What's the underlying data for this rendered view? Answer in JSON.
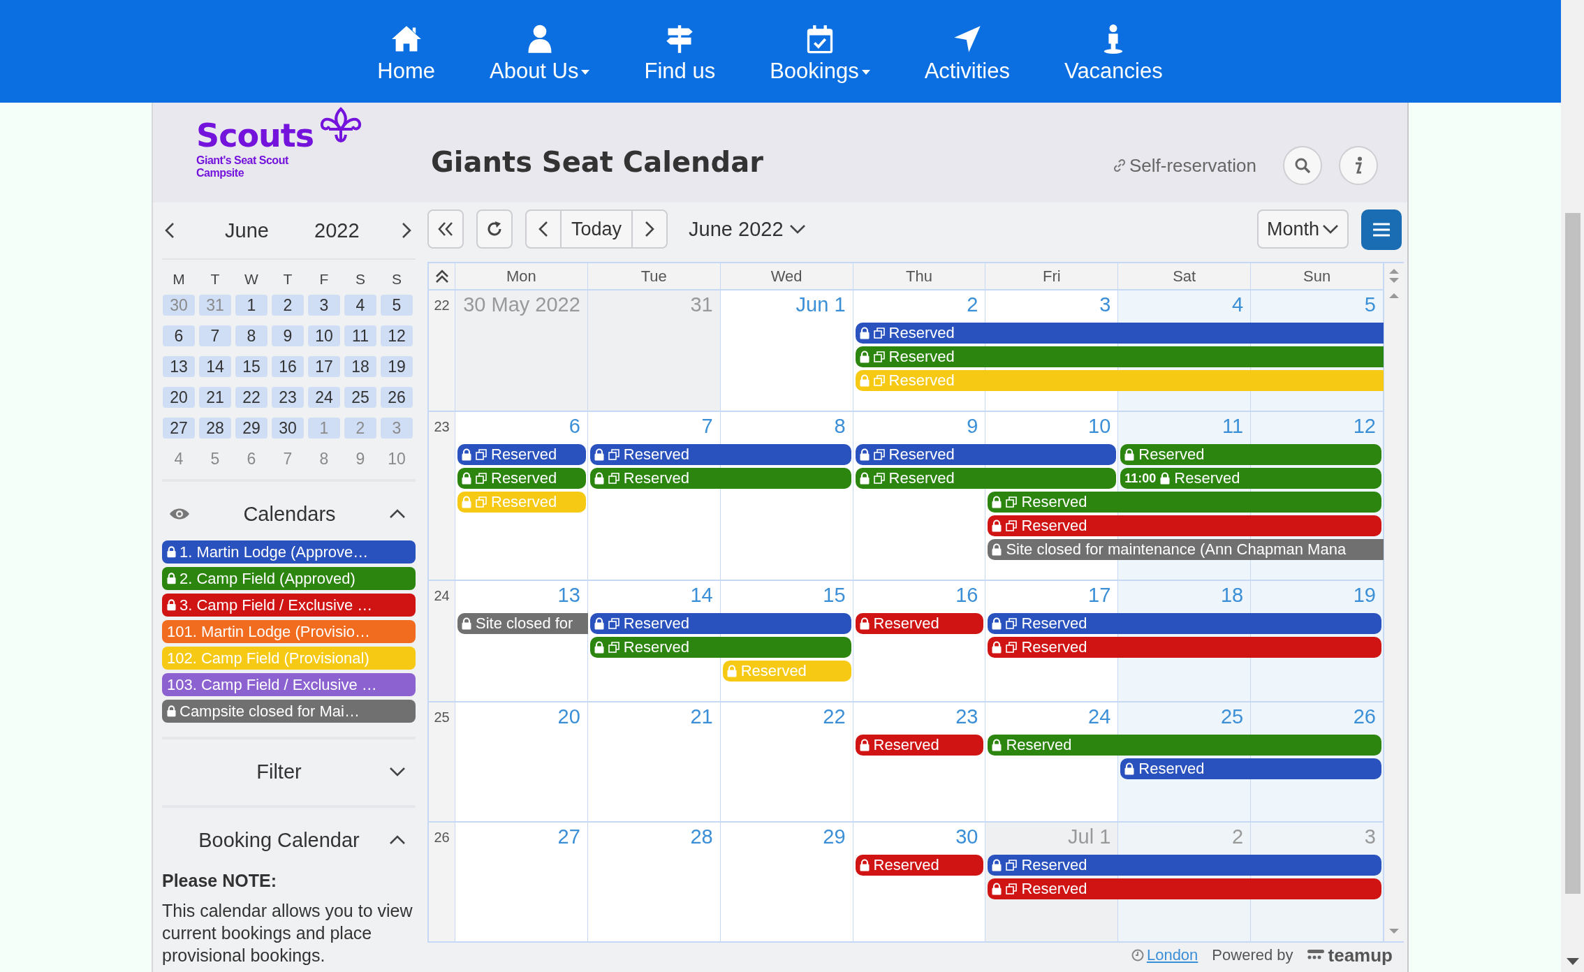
{
  "nav": [
    {
      "label": "Home",
      "dropdown": false
    },
    {
      "label": "About Us",
      "dropdown": true
    },
    {
      "label": "Find us",
      "dropdown": false
    },
    {
      "label": "Bookings",
      "dropdown": true
    },
    {
      "label": "Activities",
      "dropdown": false
    },
    {
      "label": "Vacancies",
      "dropdown": false
    }
  ],
  "logo": {
    "name": "Scouts",
    "lines": [
      "Giant's Seat Scout",
      "Campsite"
    ]
  },
  "title": "Giants Seat Calendar",
  "self_reservation": "Self-reservation",
  "mini_calendar": {
    "month": "June",
    "year": "2022",
    "weekdays": [
      "M",
      "T",
      "W",
      "T",
      "F",
      "S",
      "S"
    ],
    "weeks": [
      {
        "in_view": true,
        "days": [
          {
            "label": "30",
            "other_month": true
          },
          {
            "label": "31",
            "other_month": true
          },
          {
            "label": "1",
            "other_month": false
          },
          {
            "label": "2",
            "other_month": false
          },
          {
            "label": "3",
            "other_month": false
          },
          {
            "label": "4",
            "other_month": false
          },
          {
            "label": "5",
            "other_month": false
          }
        ]
      },
      {
        "in_view": true,
        "days": [
          {
            "label": "6",
            "other_month": false
          },
          {
            "label": "7",
            "other_month": false
          },
          {
            "label": "8",
            "other_month": false
          },
          {
            "label": "9",
            "other_month": false
          },
          {
            "label": "10",
            "other_month": false
          },
          {
            "label": "11",
            "other_month": false
          },
          {
            "label": "12",
            "other_month": false
          }
        ]
      },
      {
        "in_view": true,
        "days": [
          {
            "label": "13",
            "other_month": false
          },
          {
            "label": "14",
            "other_month": false
          },
          {
            "label": "15",
            "other_month": false
          },
          {
            "label": "16",
            "other_month": false
          },
          {
            "label": "17",
            "other_month": false
          },
          {
            "label": "18",
            "other_month": false
          },
          {
            "label": "19",
            "other_month": false
          }
        ]
      },
      {
        "in_view": true,
        "days": [
          {
            "label": "20",
            "other_month": false
          },
          {
            "label": "21",
            "other_month": false
          },
          {
            "label": "22",
            "other_month": false
          },
          {
            "label": "23",
            "other_month": false
          },
          {
            "label": "24",
            "other_month": false
          },
          {
            "label": "25",
            "other_month": false
          },
          {
            "label": "26",
            "other_month": false
          }
        ]
      },
      {
        "in_view": true,
        "days": [
          {
            "label": "27",
            "other_month": false
          },
          {
            "label": "28",
            "other_month": false
          },
          {
            "label": "29",
            "other_month": false
          },
          {
            "label": "30",
            "other_month": false
          },
          {
            "label": "1",
            "other_month": true
          },
          {
            "label": "2",
            "other_month": true
          },
          {
            "label": "3",
            "other_month": true
          }
        ]
      },
      {
        "in_view": false,
        "days": [
          {
            "label": "4",
            "other_month": true
          },
          {
            "label": "5",
            "other_month": true
          },
          {
            "label": "6",
            "other_month": true
          },
          {
            "label": "7",
            "other_month": true
          },
          {
            "label": "8",
            "other_month": true
          },
          {
            "label": "9",
            "other_month": true
          },
          {
            "label": "10",
            "other_month": true
          }
        ]
      }
    ]
  },
  "calendars_panel": {
    "title": "Calendars",
    "expanded": true,
    "items": [
      {
        "label": "1. Martin Lodge (Approve…",
        "color": "#2a52be",
        "locked": true
      },
      {
        "label": "2. Camp Field (Approved)",
        "color": "#2b850e",
        "locked": true
      },
      {
        "label": "3. Camp Field / Exclusive …",
        "color": "#d01414",
        "locked": true
      },
      {
        "label": "101. Martin Lodge (Provisio…",
        "color": "#f26c1f",
        "locked": false
      },
      {
        "label": "102. Camp Field (Provisional)",
        "color": "#f6c915",
        "locked": false
      },
      {
        "label": "103. Camp Field / Exclusive …",
        "color": "#8b62d0",
        "locked": false
      },
      {
        "label": "Campsite closed for Mai…",
        "color": "#707070",
        "locked": true
      }
    ]
  },
  "filter": {
    "title": "Filter",
    "expanded": false
  },
  "booking_info": {
    "title": "Booking Calendar",
    "expanded": true,
    "heading": "Please NOTE:",
    "text": "This calendar allows you to view current bookings and place provisional bookings."
  },
  "toolbar": {
    "today": "Today",
    "period": "June 2022",
    "view": "Month"
  },
  "calendar": {
    "weekdays": [
      "Mon",
      "Tue",
      "Wed",
      "Thu",
      "Fri",
      "Sat",
      "Sun"
    ],
    "weeks": [
      {
        "number": "22",
        "days": [
          {
            "label": "30 May 2022",
            "other_month": true
          },
          {
            "label": "31",
            "other_month": true
          },
          {
            "label": "Jun 1",
            "other_month": false
          },
          {
            "label": "2",
            "other_month": false
          },
          {
            "label": "3",
            "other_month": false
          },
          {
            "label": "4",
            "other_month": false
          },
          {
            "label": "5",
            "other_month": false
          }
        ],
        "lanes": [
          [
            {
              "kind": "gap"
            },
            {
              "kind": "gap"
            },
            {
              "kind": "gap"
            },
            {
              "kind": "event",
              "color": "#2a52be",
              "locked": true,
              "copy": true,
              "title": "Reserved",
              "continues": true
            },
            {
              "kind": "more"
            },
            {
              "kind": "more"
            },
            {
              "kind": "more"
            }
          ],
          [
            {
              "kind": "gap"
            },
            {
              "kind": "gap"
            },
            {
              "kind": "gap"
            },
            {
              "kind": "event",
              "color": "#2b850e",
              "locked": true,
              "copy": true,
              "title": "Reserved",
              "continues": true
            },
            {
              "kind": "more"
            },
            {
              "kind": "more"
            },
            {
              "kind": "more"
            }
          ],
          [
            {
              "kind": "gap"
            },
            {
              "kind": "gap"
            },
            {
              "kind": "gap"
            },
            {
              "kind": "event",
              "color": "#f6c915",
              "locked": true,
              "copy": true,
              "title": "Reserved",
              "continues": true
            },
            {
              "kind": "more"
            },
            {
              "kind": "more"
            },
            {
              "kind": "more"
            }
          ]
        ]
      },
      {
        "number": "23",
        "days": [
          {
            "label": "6",
            "other_month": false
          },
          {
            "label": "7",
            "other_month": false
          },
          {
            "label": "8",
            "other_month": false
          },
          {
            "label": "9",
            "other_month": false
          },
          {
            "label": "10",
            "other_month": false
          },
          {
            "label": "11",
            "other_month": false
          },
          {
            "label": "12",
            "other_month": false
          }
        ],
        "lanes": [
          [
            {
              "kind": "event",
              "color": "#2a52be",
              "locked": true,
              "copy": true,
              "title": "Reserved",
              "continues": false
            },
            {
              "kind": "event",
              "color": "#2a52be",
              "locked": true,
              "copy": true,
              "title": "Reserved",
              "continues": false
            },
            {
              "kind": "more"
            },
            {
              "kind": "event",
              "color": "#2a52be",
              "locked": true,
              "copy": true,
              "title": "Reserved",
              "continues": false
            },
            {
              "kind": "more"
            },
            {
              "kind": "event",
              "color": "#2b850e",
              "locked": true,
              "copy": false,
              "title": "Reserved",
              "continues": false
            },
            {
              "kind": "more"
            }
          ],
          [
            {
              "kind": "event",
              "color": "#2b850e",
              "locked": true,
              "copy": true,
              "title": "Reserved",
              "continues": false
            },
            {
              "kind": "event",
              "color": "#2b850e",
              "locked": true,
              "copy": true,
              "title": "Reserved",
              "continues": false
            },
            {
              "kind": "more"
            },
            {
              "kind": "event",
              "color": "#2b850e",
              "locked": true,
              "copy": true,
              "title": "Reserved",
              "continues": false
            },
            {
              "kind": "more"
            },
            {
              "kind": "event",
              "color": "#2b850e",
              "locked": true,
              "copy": false,
              "time": "11:00",
              "title": "Reserved",
              "continues": false
            },
            {
              "kind": "more"
            }
          ],
          [
            {
              "kind": "event",
              "color": "#f6c915",
              "locked": true,
              "copy": true,
              "title": "Reserved",
              "continues": false
            },
            {
              "kind": "gap"
            },
            {
              "kind": "gap"
            },
            {
              "kind": "gap"
            },
            {
              "kind": "event",
              "color": "#2b850e",
              "locked": true,
              "copy": true,
              "title": "Reserved",
              "continues": false
            },
            {
              "kind": "more"
            },
            {
              "kind": "more"
            }
          ],
          [
            {
              "kind": "gap"
            },
            {
              "kind": "gap"
            },
            {
              "kind": "gap"
            },
            {
              "kind": "gap"
            },
            {
              "kind": "event",
              "color": "#d01414",
              "locked": true,
              "copy": true,
              "title": "Reserved",
              "continues": false
            },
            {
              "kind": "more"
            },
            {
              "kind": "more"
            }
          ],
          [
            {
              "kind": "gap"
            },
            {
              "kind": "gap"
            },
            {
              "kind": "gap"
            },
            {
              "kind": "gap"
            },
            {
              "kind": "event",
              "color": "#707070",
              "locked": true,
              "copy": false,
              "title": "Site closed for maintenance (Ann Chapman Mana",
              "continues": true
            },
            {
              "kind": "more"
            },
            {
              "kind": "more"
            }
          ]
        ]
      },
      {
        "number": "24",
        "days": [
          {
            "label": "13",
            "other_month": false
          },
          {
            "label": "14",
            "other_month": false
          },
          {
            "label": "15",
            "other_month": false
          },
          {
            "label": "16",
            "other_month": false
          },
          {
            "label": "17",
            "other_month": false
          },
          {
            "label": "18",
            "other_month": false
          },
          {
            "label": "19",
            "other_month": false
          }
        ],
        "lanes": [
          [
            {
              "kind": "event",
              "color": "#707070",
              "locked": true,
              "copy": false,
              "title": "Site closed for",
              "continues": true
            },
            {
              "kind": "event",
              "color": "#2a52be",
              "locked": true,
              "copy": true,
              "title": "Reserved",
              "continues": false
            },
            {
              "kind": "more"
            },
            {
              "kind": "event",
              "color": "#d01414",
              "locked": true,
              "copy": false,
              "title": "Reserved",
              "continues": false
            },
            {
              "kind": "event",
              "color": "#2a52be",
              "locked": true,
              "copy": true,
              "title": "Reserved",
              "continues": false
            },
            {
              "kind": "more"
            },
            {
              "kind": "more"
            }
          ],
          [
            {
              "kind": "gap"
            },
            {
              "kind": "event",
              "color": "#2b850e",
              "locked": true,
              "copy": true,
              "title": "Reserved",
              "continues": false
            },
            {
              "kind": "more"
            },
            {
              "kind": "gap"
            },
            {
              "kind": "event",
              "color": "#d01414",
              "locked": true,
              "copy": true,
              "title": "Reserved",
              "continues": false
            },
            {
              "kind": "more"
            },
            {
              "kind": "more"
            }
          ],
          [
            {
              "kind": "gap"
            },
            {
              "kind": "gap"
            },
            {
              "kind": "event",
              "color": "#f6c915",
              "locked": true,
              "copy": false,
              "title": "Reserved",
              "continues": false
            },
            {
              "kind": "gap"
            },
            {
              "kind": "gap"
            },
            {
              "kind": "gap"
            },
            {
              "kind": "gap"
            }
          ]
        ]
      },
      {
        "number": "25",
        "days": [
          {
            "label": "20",
            "other_month": false
          },
          {
            "label": "21",
            "other_month": false
          },
          {
            "label": "22",
            "other_month": false
          },
          {
            "label": "23",
            "other_month": false
          },
          {
            "label": "24",
            "other_month": false
          },
          {
            "label": "25",
            "other_month": false
          },
          {
            "label": "26",
            "other_month": false
          }
        ],
        "lanes": [
          [
            {
              "kind": "gap"
            },
            {
              "kind": "gap"
            },
            {
              "kind": "gap"
            },
            {
              "kind": "event",
              "color": "#d01414",
              "locked": true,
              "copy": false,
              "title": "Reserved",
              "continues": false
            },
            {
              "kind": "event",
              "color": "#2b850e",
              "locked": true,
              "copy": false,
              "title": "Reserved",
              "continues": false
            },
            {
              "kind": "more"
            },
            {
              "kind": "more"
            }
          ],
          [
            {
              "kind": "gap"
            },
            {
              "kind": "gap"
            },
            {
              "kind": "gap"
            },
            {
              "kind": "gap"
            },
            {
              "kind": "gap"
            },
            {
              "kind": "event",
              "color": "#2a52be",
              "locked": true,
              "copy": false,
              "title": "Reserved",
              "continues": false
            },
            {
              "kind": "more"
            }
          ]
        ]
      },
      {
        "number": "26",
        "days": [
          {
            "label": "27",
            "other_month": false
          },
          {
            "label": "28",
            "other_month": false
          },
          {
            "label": "29",
            "other_month": false
          },
          {
            "label": "30",
            "other_month": false
          },
          {
            "label": "Jul 1",
            "other_month": true
          },
          {
            "label": "2",
            "other_month": true
          },
          {
            "label": "3",
            "other_month": true
          }
        ],
        "lanes": [
          [
            {
              "kind": "gap"
            },
            {
              "kind": "gap"
            },
            {
              "kind": "gap"
            },
            {
              "kind": "event",
              "color": "#d01414",
              "locked": true,
              "copy": false,
              "title": "Reserved",
              "continues": false
            },
            {
              "kind": "event",
              "color": "#2a52be",
              "locked": true,
              "copy": true,
              "title": "Reserved",
              "continues": false
            },
            {
              "kind": "more"
            },
            {
              "kind": "more"
            }
          ],
          [
            {
              "kind": "gap"
            },
            {
              "kind": "gap"
            },
            {
              "kind": "gap"
            },
            {
              "kind": "gap"
            },
            {
              "kind": "event",
              "color": "#d01414",
              "locked": true,
              "copy": true,
              "title": "Reserved",
              "continues": false
            },
            {
              "kind": "more"
            },
            {
              "kind": "more"
            }
          ]
        ]
      }
    ]
  },
  "footer": {
    "timezone": "London",
    "powered_by": "Powered by",
    "brand": "teamup"
  }
}
